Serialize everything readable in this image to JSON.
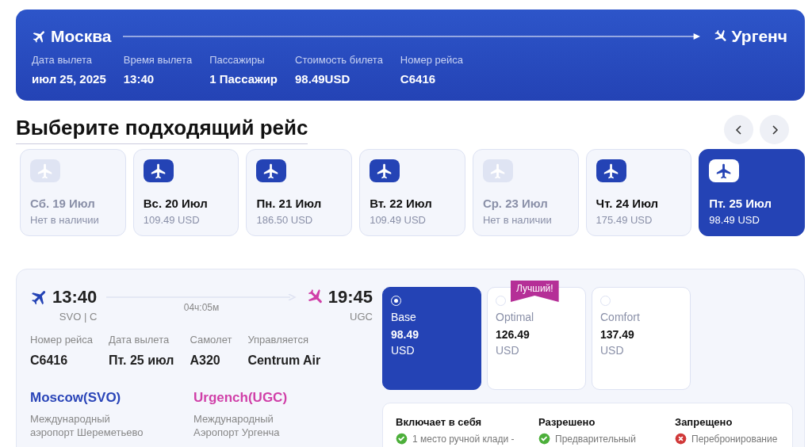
{
  "route": {
    "from": "Москва",
    "to": "Ургенч",
    "details": [
      {
        "label": "Дата вылета",
        "value": "июл 25, 2025"
      },
      {
        "label": "Время вылета",
        "value": "13:40"
      },
      {
        "label": "Пассажиры",
        "value": "1 Пассажир"
      },
      {
        "label": "Стоимость билета",
        "value": "98.49USD"
      },
      {
        "label": "Номер рейса",
        "value": "C6416"
      }
    ]
  },
  "section_title": "Выберите подходящий рейс",
  "dates": [
    {
      "date": "Сб. 19 Июл",
      "price": "Нет в наличии",
      "available": false,
      "selected": false
    },
    {
      "date": "Вс. 20 Июл",
      "price": "109.49 USD",
      "available": true,
      "selected": false
    },
    {
      "date": "Пн. 21 Июл",
      "price": "186.50 USD",
      "available": true,
      "selected": false
    },
    {
      "date": "Вт. 22 Июл",
      "price": "109.49 USD",
      "available": true,
      "selected": false
    },
    {
      "date": "Ср. 23 Июл",
      "price": "Нет в наличии",
      "available": false,
      "selected": false
    },
    {
      "date": "Чт. 24 Июл",
      "price": "175.49 USD",
      "available": true,
      "selected": false
    },
    {
      "date": "Пт. 25 Июл",
      "price": "98.49 USD",
      "available": true,
      "selected": true
    }
  ],
  "flight": {
    "depart_time": "13:40",
    "depart_code": "SVO | C",
    "duration": "04ч:05м",
    "arrive_time": "19:45",
    "arrive_code": "UGC",
    "info": [
      {
        "label": "Номер рейса",
        "value": "C6416"
      },
      {
        "label": "Дата вылета",
        "value": "Пт. 25 июл"
      },
      {
        "label": "Самолет",
        "value": "A320"
      },
      {
        "label": "Управляется",
        "value": "Centrum Air"
      }
    ],
    "airports": [
      {
        "city": "Moscow(SVO)",
        "name": "Международный аэропорт Шереметьево",
        "color": "#2a45b8"
      },
      {
        "city": "Urgench(UGC)",
        "name": "Международный Аэропорт Ургенча",
        "color": "#d03fa8"
      }
    ]
  },
  "fares": [
    {
      "name": "Base",
      "price": "98.49",
      "currency": "USD",
      "selected": true
    },
    {
      "name": "Optimal",
      "price": "126.49",
      "currency": "USD",
      "selected": false,
      "badge": "Лучший!"
    },
    {
      "name": "Comfort",
      "price": "137.49",
      "currency": "USD",
      "selected": false
    }
  ],
  "conditions": [
    {
      "title": "Включает в себя",
      "items": [
        {
          "kind": "allowed",
          "text": "1 место ручной клади -"
        }
      ]
    },
    {
      "title": "Разрешено",
      "items": [
        {
          "kind": "allowed",
          "text": "Предварительный"
        }
      ]
    },
    {
      "title": "Запрещено",
      "items": [
        {
          "kind": "forbidden",
          "text": "Перебронирование"
        }
      ]
    }
  ]
}
